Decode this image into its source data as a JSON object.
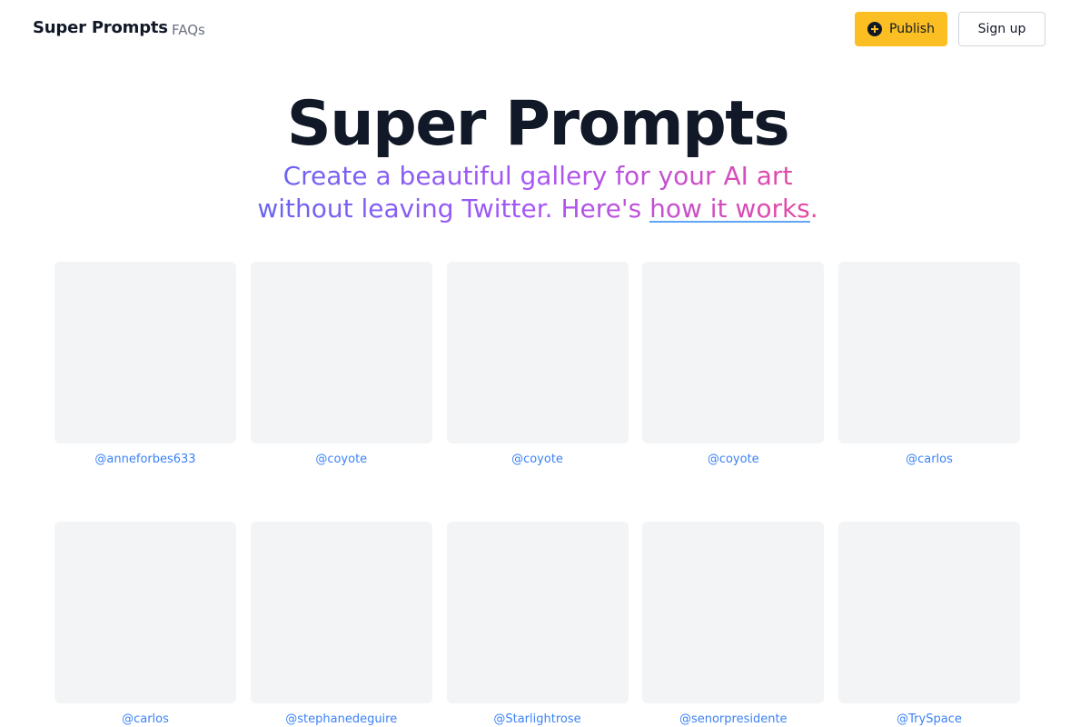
{
  "nav": {
    "brand": "Super Prompts",
    "faqs_label": "FAQs",
    "publish_label": "Publish",
    "signup_label": "Sign up",
    "publish_icon": "plus-circle-icon"
  },
  "hero": {
    "title": "Super Prompts",
    "subtitle_prefix": "Create a beautiful gallery for your AI art without leaving Twitter. Here's ",
    "subtitle_link": "how it works",
    "subtitle_suffix": "."
  },
  "gallery": {
    "items": [
      {
        "handle": "@anneforbes633"
      },
      {
        "handle": "@coyote"
      },
      {
        "handle": "@coyote"
      },
      {
        "handle": "@coyote"
      },
      {
        "handle": "@carlos"
      },
      {
        "handle": "@carlos"
      },
      {
        "handle": "@stephanedeguire"
      },
      {
        "handle": "@Starlightrose"
      },
      {
        "handle": "@senorpresidente"
      },
      {
        "handle": "@TrySpace"
      }
    ]
  },
  "colors": {
    "publish_bg": "#fbbf24",
    "link_blue": "#3b82f6",
    "card_bg": "#f3f4f6",
    "gradient_start": "#6366f1",
    "gradient_mid": "#a855f7",
    "gradient_end": "#ec4899"
  }
}
